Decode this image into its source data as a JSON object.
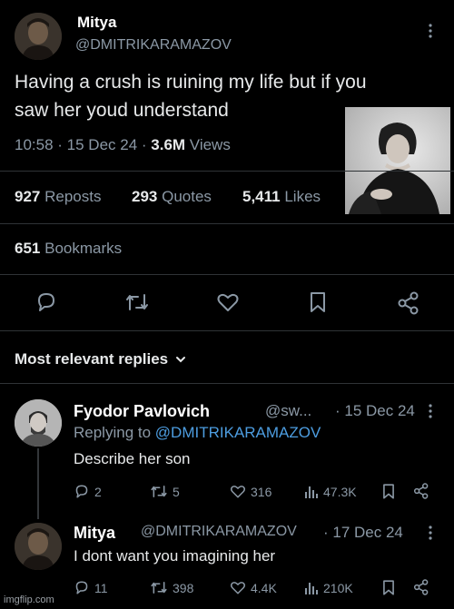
{
  "tweet": {
    "display_name": "Mitya",
    "handle": "@DMITRIKARAMAZOV",
    "text_line1": "Having a crush is ruining my life but if you",
    "text_line2": "saw her youd understand",
    "time": "10:58",
    "date": "15 Dec 24",
    "views_count": "3.6M",
    "views_label": "Views",
    "reposts_count": "927",
    "reposts_label": "Reposts",
    "quotes_count": "293",
    "quotes_label": "Quotes",
    "likes_count": "5,411",
    "likes_label": "Likes",
    "bookmarks_count": "651",
    "bookmarks_label": "Bookmarks"
  },
  "replies_header": "Most relevant replies",
  "replies": [
    {
      "display_name": "Fyodor Pavlovich",
      "handle": "@sw...",
      "date": "· 15 Dec 24",
      "replying_label": "Replying to",
      "replying_handle": "@DMITRIKARAMAZOV",
      "text": "Describe her son",
      "replies": "2",
      "reposts": "5",
      "likes": "316",
      "views": "47.3K"
    },
    {
      "display_name": "Mitya",
      "handle": "@DMITRIKARAMAZOV",
      "date": "· 17 Dec 24",
      "text": "I dont want you imagining her",
      "replies": "11",
      "reposts": "398",
      "likes": "4.4K",
      "views": "210K"
    }
  ],
  "watermark": "imgflip.com",
  "colors": {
    "background": "#000000",
    "text": "#e7e9ea",
    "muted": "#8b98a5",
    "link": "#4d9de0",
    "divider": "#2f3336"
  }
}
